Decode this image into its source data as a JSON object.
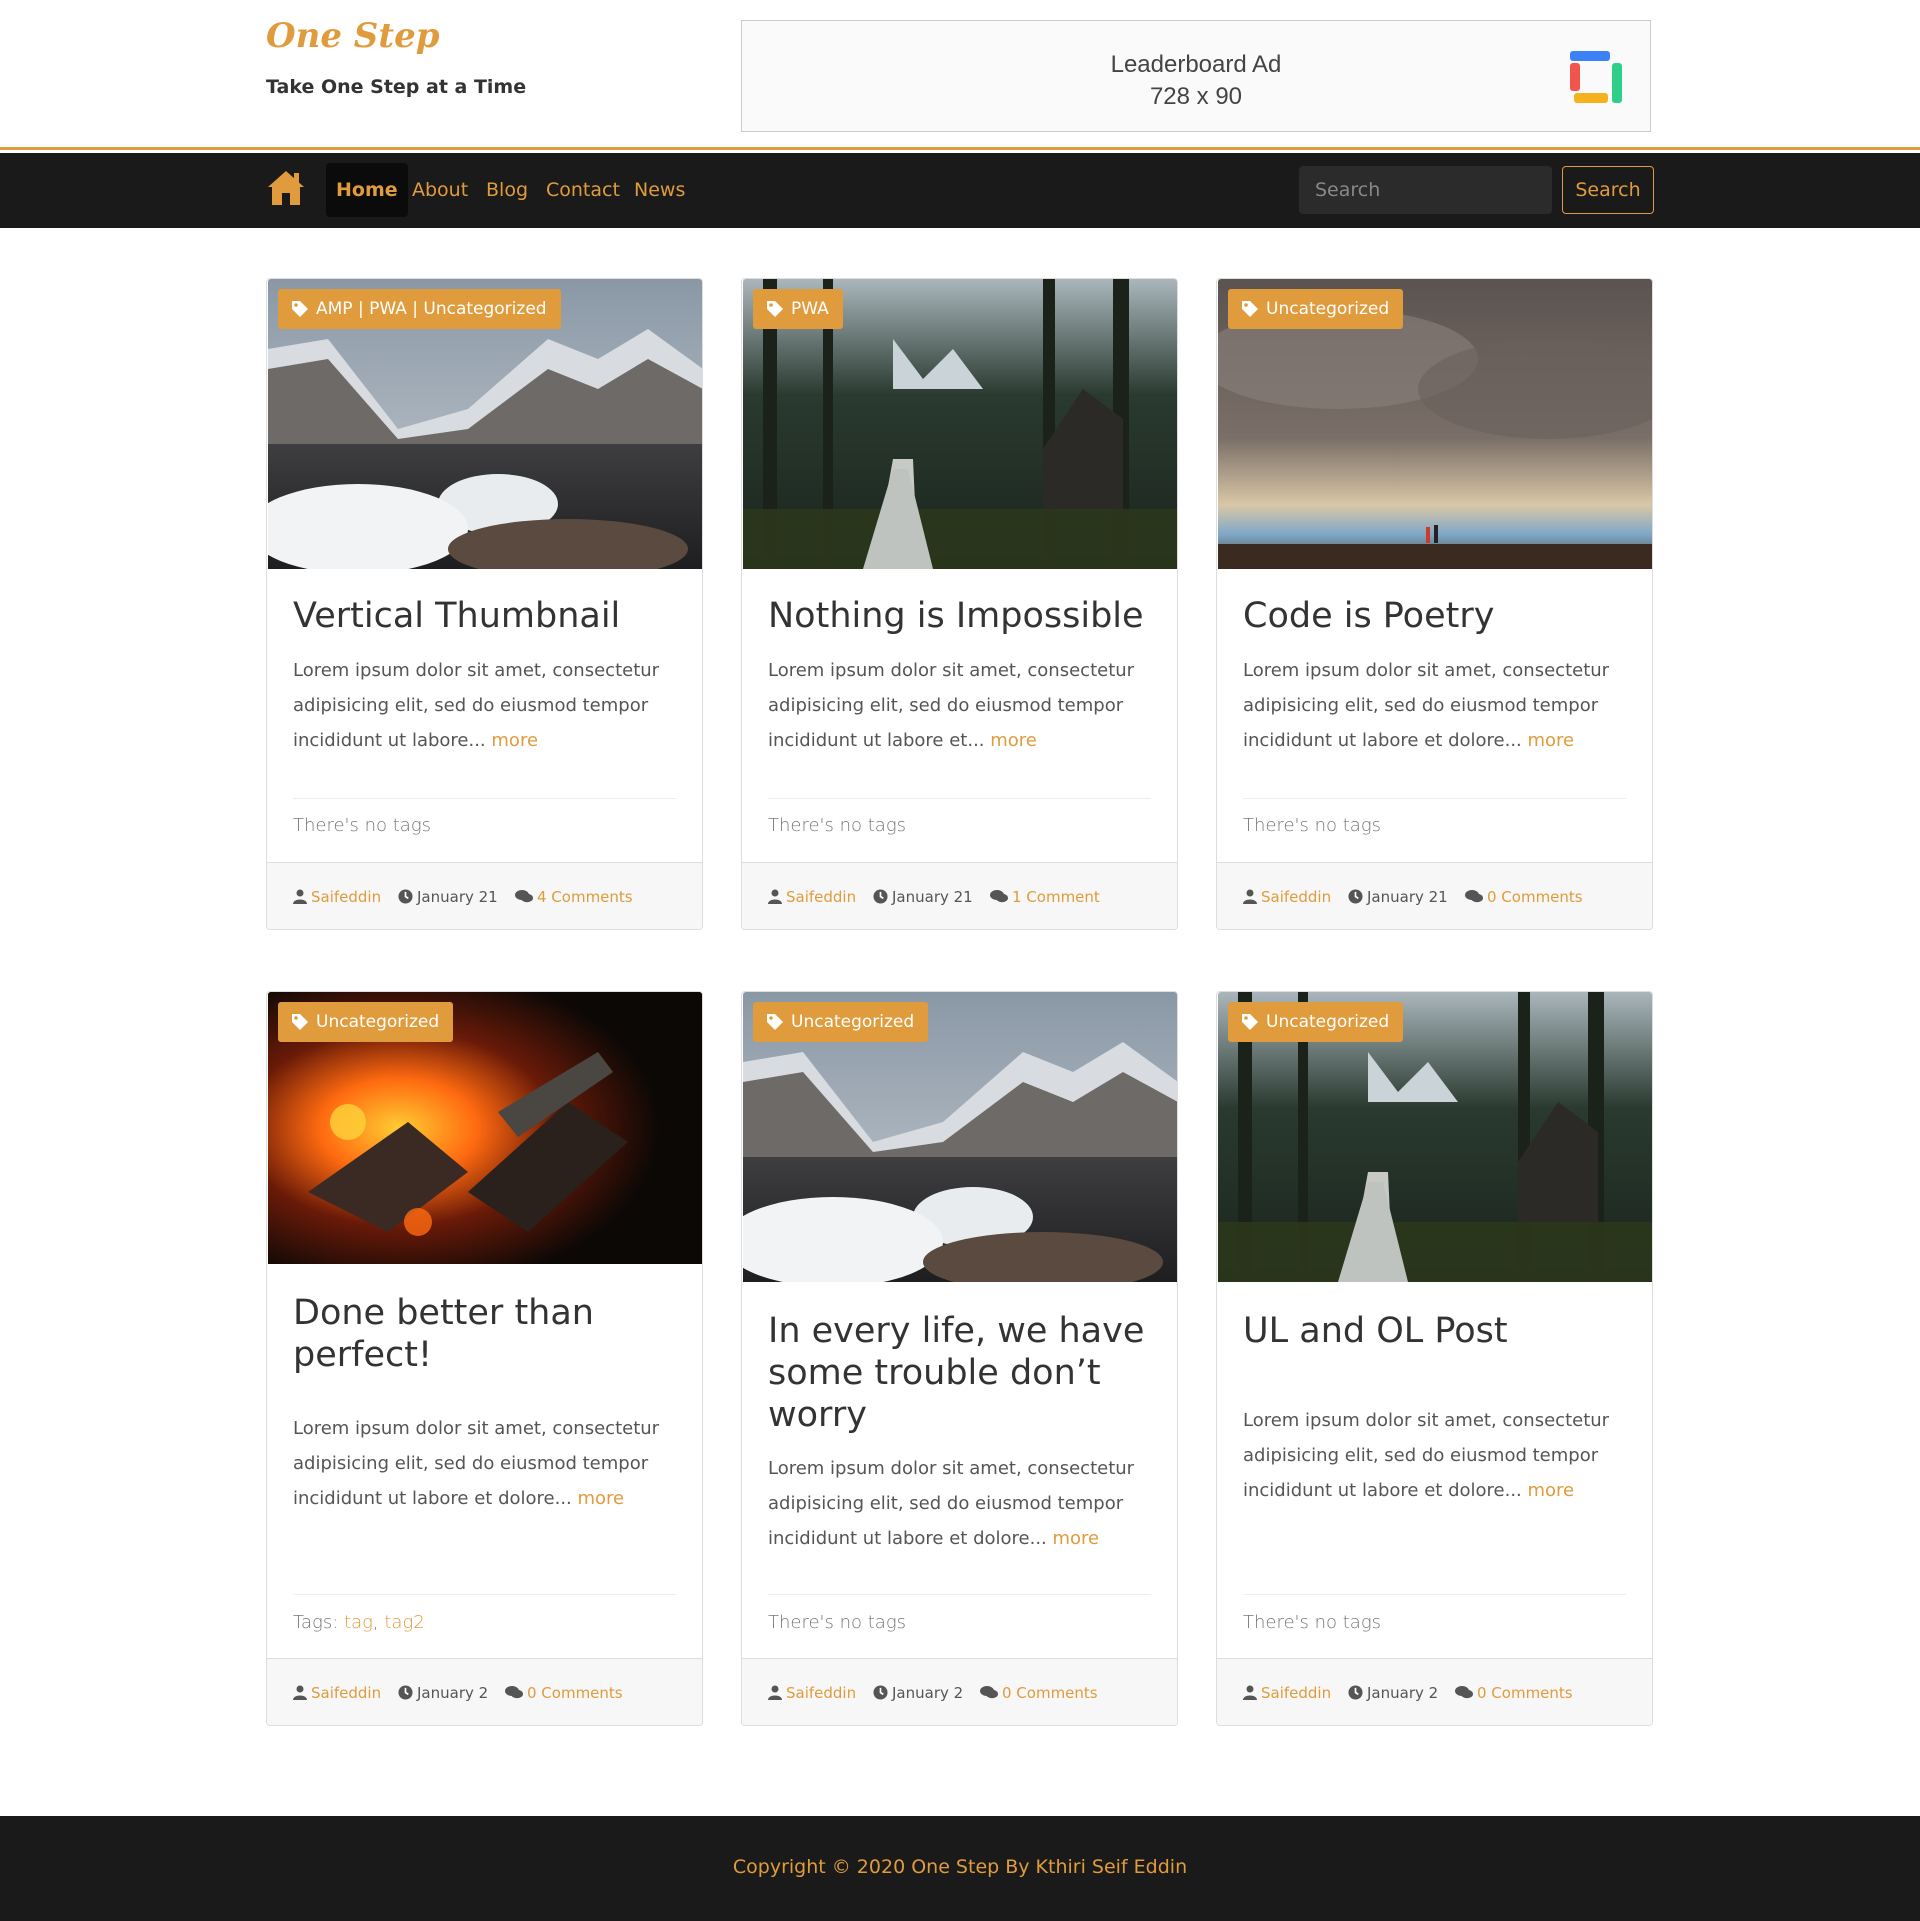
{
  "brand": {
    "title": "One Step",
    "tagline": "Take One Step at a Time"
  },
  "ad": {
    "line1": "Leaderboard Ad",
    "line2": "728 x 90"
  },
  "nav": {
    "items": [
      {
        "label": "Home",
        "active": true
      },
      {
        "label": "About"
      },
      {
        "label": "Blog"
      },
      {
        "label": "Contact"
      },
      {
        "label": "News"
      }
    ],
    "search_placeholder": "Search",
    "search_button": "Search"
  },
  "colors": {
    "accent": "#e09b3d",
    "dark": "#1a1a1a"
  },
  "posts": [
    {
      "category": "AMP | PWA | Uncategorized",
      "image": "snowy-mountain-lake",
      "title": "Vertical Thumbnail",
      "excerpt": "Lorem ipsum dolor sit amet, consectetur adipisicing elit, sed do eiusmod tempor incididunt ut labore...",
      "more": "more",
      "tags_text": "There's no tags",
      "author": "Saifeddin",
      "date": "January 21",
      "comments": "4 Comments"
    },
    {
      "category": "PWA",
      "image": "forest-path-cabin",
      "title": "Nothing is Impossible",
      "excerpt": "Lorem ipsum dolor sit amet, consectetur adipisicing elit, sed do eiusmod tempor incididunt ut labore et...",
      "more": "more",
      "tags_text": "There's no tags",
      "author": "Saifeddin",
      "date": "January 21",
      "comments": "1 Comment"
    },
    {
      "category": "Uncategorized",
      "image": "cloudy-sky-couple",
      "title": "Code is Poetry",
      "excerpt": "Lorem ipsum dolor sit amet, consectetur adipisicing elit, sed do eiusmod tempor incididunt ut labore et dolore...",
      "more": "more",
      "tags_text": "There's no tags",
      "author": "Saifeddin",
      "date": "January 21",
      "comments": "0 Comments"
    },
    {
      "category": "Uncategorized",
      "image": "campfire",
      "title": "Done better than perfect!",
      "excerpt": "Lorem ipsum dolor sit amet, consectetur adipisicing elit, sed do eiusmod tempor incididunt ut labore et dolore...",
      "more": "more",
      "tags_label": "Tags: ",
      "tags": [
        "tag",
        "tag2"
      ],
      "author": "Saifeddin",
      "date": "January 2",
      "comments": "0 Comments"
    },
    {
      "category": "Uncategorized",
      "image": "snowy-mountain-lake",
      "title": "In every life, we have some trouble don’t worry",
      "excerpt": "Lorem ipsum dolor sit amet, consectetur adipisicing elit, sed do eiusmod tempor incididunt ut labore et dolore...",
      "more": "more",
      "tags_text": "There's no tags",
      "author": "Saifeddin",
      "date": "January 2",
      "comments": "0 Comments"
    },
    {
      "category": "Uncategorized",
      "image": "forest-path-cabin",
      "title": "UL and OL Post",
      "excerpt": "Lorem ipsum dolor sit amet, consectetur adipisicing elit, sed do eiusmod tempor incididunt ut labore et dolore...",
      "more": "more",
      "tags_text": "There's no tags",
      "author": "Saifeddin",
      "date": "January 2",
      "comments": "0 Comments"
    }
  ],
  "footer": {
    "copyright": "Copyright © 2020 One Step By Kthiri Seif Eddin"
  }
}
